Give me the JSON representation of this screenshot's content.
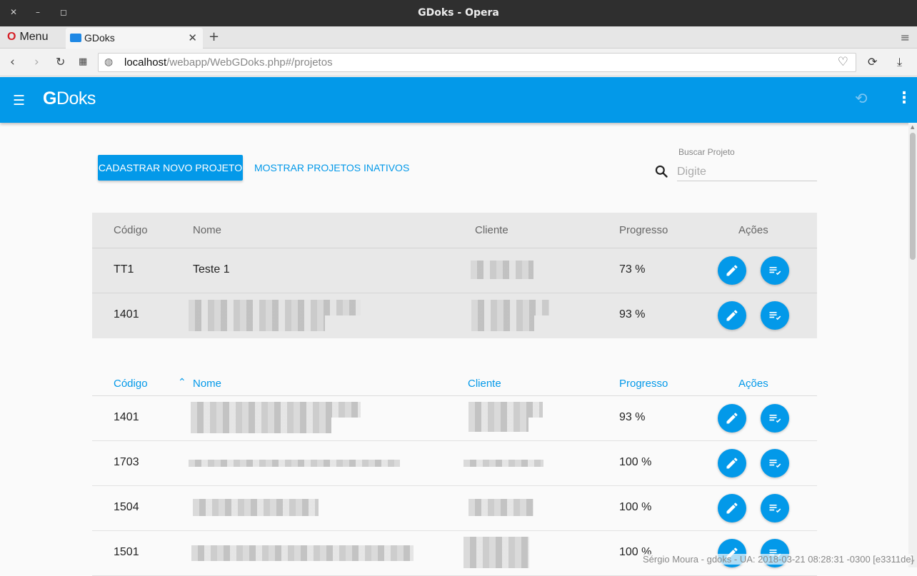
{
  "window": {
    "title": "GDoks - Opera"
  },
  "browser": {
    "menu_label": "Menu",
    "tab_label": "GDoks",
    "url_host": "localhost",
    "url_path": "/webapp/WebGDoks.php#/projetos"
  },
  "app": {
    "logo_g": "G",
    "logo_rest": "Doks",
    "history_icon": "history-icon",
    "more_icon": "more-vert-icon"
  },
  "toolbar": {
    "new_project_label": "CADASTRAR NOVO PROJETO",
    "show_inactive_label": "MOSTRAR PROJETOS INATIVOS",
    "search_label": "Buscar Projeto",
    "search_placeholder": "Digite"
  },
  "table1": {
    "headers": {
      "code": "Código",
      "name": "Nome",
      "client": "Cliente",
      "progress": "Progresso",
      "actions": "Ações"
    },
    "rows": [
      {
        "code": "TT1",
        "name": "Teste 1",
        "progress": "73 %"
      },
      {
        "code": "1401",
        "name": "",
        "progress": "93 %"
      }
    ]
  },
  "table2": {
    "headers": {
      "code": "Código",
      "name": "Nome",
      "client": "Cliente",
      "progress": "Progresso",
      "actions": "Ações"
    },
    "sort_icon": "chevron-up-icon",
    "rows": [
      {
        "code": "1401",
        "progress": "93 %"
      },
      {
        "code": "1703",
        "progress": "100 %"
      },
      {
        "code": "1504",
        "progress": "100 %"
      },
      {
        "code": "1501",
        "progress": "100 %"
      }
    ]
  },
  "status": {
    "text": "Sérgio Moura - gdoks - UA: 2018-03-21 08:28:31 -0300 [e3311de]"
  },
  "colors": {
    "primary": "#0399e9",
    "table_bg": "#e8e8e8"
  }
}
